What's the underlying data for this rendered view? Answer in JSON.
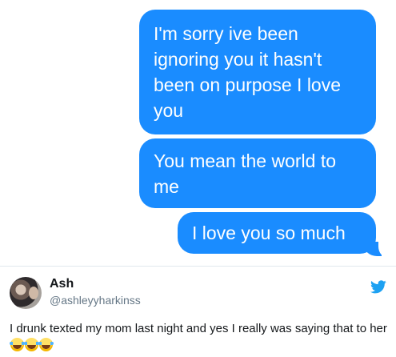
{
  "messages": [
    {
      "text": "I'm sorry ive been ignoring you it hasn't been on purpose I love you"
    },
    {
      "text": "You mean the world to me"
    },
    {
      "text": "I love you so much"
    }
  ],
  "tweet": {
    "name": "Ash",
    "handle": "@ashleyyharkinss",
    "text": "I drunk texted my mom last night and yes I really was saying that to her",
    "emojis": [
      "face-with-tears-of-joy",
      "face-with-tears-of-joy",
      "face-with-tears-of-joy"
    ],
    "bird_color": "#1da1f2"
  },
  "colors": {
    "bubble": "#1a8cff",
    "divider": "#e1e8ed"
  }
}
